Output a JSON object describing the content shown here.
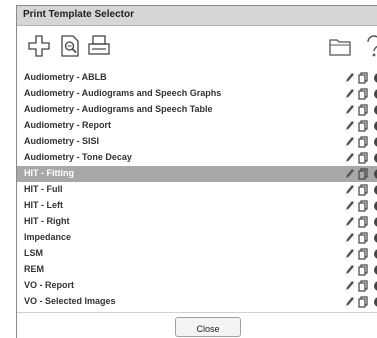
{
  "window": {
    "title": "Print Template Selector"
  },
  "toolbar": {
    "icons": [
      "add-icon",
      "search-document-icon",
      "printer-icon",
      "folder-icon",
      "help-icon"
    ]
  },
  "templates": [
    {
      "label": "Audiometry - ABLB",
      "selected": false
    },
    {
      "label": "Audiometry - Audiograms and Speech Graphs",
      "selected": false
    },
    {
      "label": "Audiometry - Audiograms and Speech Table",
      "selected": false
    },
    {
      "label": "Audiometry - Report",
      "selected": false
    },
    {
      "label": "Audiometry - SISI",
      "selected": false
    },
    {
      "label": "Audiometry - Tone Decay",
      "selected": false
    },
    {
      "label": "HIT - Fitting",
      "selected": true
    },
    {
      "label": "HIT - Full",
      "selected": false
    },
    {
      "label": "HIT - Left",
      "selected": false
    },
    {
      "label": "HIT - Right",
      "selected": false
    },
    {
      "label": "Impedance",
      "selected": false
    },
    {
      "label": "LSM",
      "selected": false
    },
    {
      "label": "REM",
      "selected": false
    },
    {
      "label": "VO - Report",
      "selected": false
    },
    {
      "label": "VO - Selected Images",
      "selected": false
    }
  ],
  "row_actions": [
    "edit-icon",
    "copy-icon",
    "delete-icon"
  ],
  "footer": {
    "close_label": "Close"
  },
  "colors": {
    "selected_row": "#a8a8a8",
    "titlebar": "#d6d6d6"
  }
}
